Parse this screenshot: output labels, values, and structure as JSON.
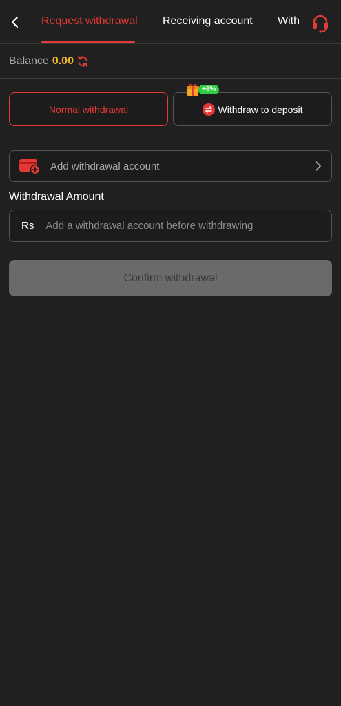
{
  "header": {
    "back_icon": "chevron-left-icon",
    "tabs": [
      {
        "label": "Request withdrawal",
        "active": true
      },
      {
        "label": "Receiving account",
        "active": false
      },
      {
        "label": "With",
        "active": false
      }
    ],
    "support_icon": "headset-icon"
  },
  "balance": {
    "label": "Balance",
    "value": "0.00",
    "refresh_icon": "refresh-icon"
  },
  "modes": {
    "normal_label": "Normal withdrawal",
    "deposit_label": "Withdraw to deposit",
    "bonus_badge": "+6%",
    "gift_icon": "gift-icon",
    "swap_icon": "swap-icon"
  },
  "account": {
    "add_label": "Add withdrawal account",
    "wallet_icon": "wallet-add-icon",
    "chevron_icon": "chevron-right-icon"
  },
  "amount": {
    "title": "Withdrawal Amount",
    "currency": "Rs",
    "placeholder": "Add a withdrawal account before withdrawing",
    "value": ""
  },
  "confirm_label": "Confirm withdrawal",
  "colors": {
    "background": "#202020",
    "accent": "#e53935",
    "balance": "#f5b82e",
    "bonus": "#2ecc40",
    "disabled_button": "#6a6a6a"
  }
}
